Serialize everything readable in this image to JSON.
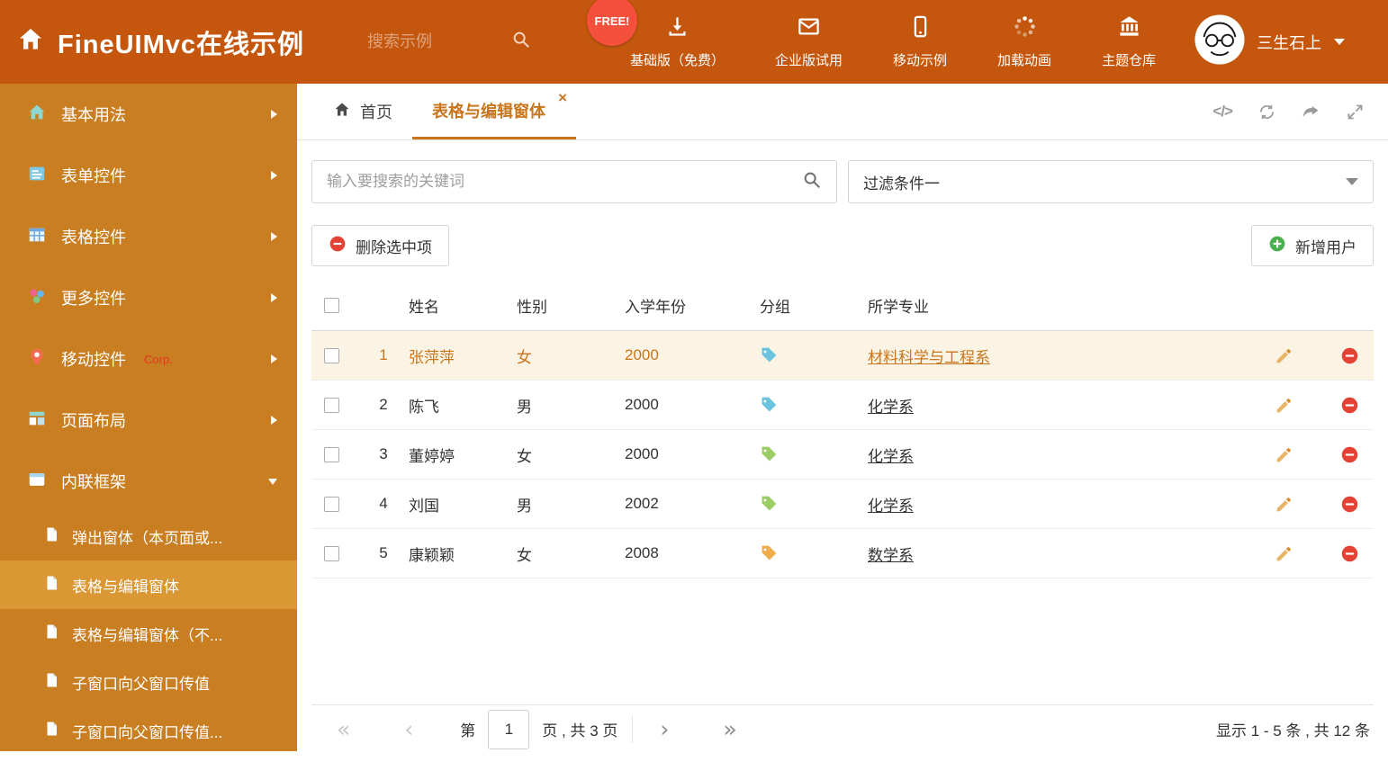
{
  "header": {
    "title": "FineUIMvc在线示例",
    "search_placeholder": "搜索示例",
    "free_badge": "FREE!",
    "nav_items": [
      {
        "label": "基础版（免费）",
        "icon": "download-icon"
      },
      {
        "label": "企业版试用",
        "icon": "mail-icon"
      },
      {
        "label": "移动示例",
        "icon": "mobile-icon"
      },
      {
        "label": "加载动画",
        "icon": "spinner-icon"
      },
      {
        "label": "主题仓库",
        "icon": "bank-icon"
      }
    ],
    "username": "三生石上"
  },
  "sidebar": {
    "items": [
      {
        "label": "基本用法",
        "icon": "home-icon"
      },
      {
        "label": "表单控件",
        "icon": "form-icon"
      },
      {
        "label": "表格控件",
        "icon": "table-icon"
      },
      {
        "label": "更多控件",
        "icon": "more-icon"
      },
      {
        "label": "移动控件",
        "badge": "Corp.",
        "icon": "pin-icon"
      },
      {
        "label": "页面布局",
        "icon": "layout-icon"
      },
      {
        "label": "内联框架",
        "icon": "frame-icon"
      }
    ],
    "subitems": [
      {
        "label": "弹出窗体（本页面或..."
      },
      {
        "label": "表格与编辑窗体",
        "active": true
      },
      {
        "label": "表格与编辑窗体（不..."
      },
      {
        "label": "子窗口向父窗口传值"
      },
      {
        "label": "子窗口向父窗口传值..."
      }
    ]
  },
  "tabbar": {
    "tabs": [
      {
        "label": "首页"
      },
      {
        "label": "表格与编辑窗体",
        "active": true,
        "closable": true
      }
    ]
  },
  "filters": {
    "search_placeholder": "输入要搜索的关键词",
    "filter_value": "过滤条件一"
  },
  "toolbar": {
    "delete_button": "删除选中项",
    "add_button": "新增用户"
  },
  "grid": {
    "columns": {
      "name": "姓名",
      "gender": "性别",
      "year": "入学年份",
      "group": "分组",
      "major": "所学专业"
    },
    "rows": [
      {
        "index": "1",
        "name": "张萍萍",
        "gender": "女",
        "year": "2000",
        "tag_color": "#6CC3E0",
        "major": "材料科学与工程系",
        "selected": true
      },
      {
        "index": "2",
        "name": "陈飞",
        "gender": "男",
        "year": "2000",
        "tag_color": "#6CC3E0",
        "major": "化学系"
      },
      {
        "index": "3",
        "name": "董婷婷",
        "gender": "女",
        "year": "2000",
        "tag_color": "#9CCC65",
        "major": "化学系"
      },
      {
        "index": "4",
        "name": "刘国",
        "gender": "男",
        "year": "2002",
        "tag_color": "#9CCC65",
        "major": "化学系"
      },
      {
        "index": "5",
        "name": "康颖颖",
        "gender": "女",
        "year": "2008",
        "tag_color": "#F0AD4E",
        "major": "数学系"
      }
    ]
  },
  "pagination": {
    "prefix": "第",
    "page": "1",
    "suffix": "页 , 共 3 页",
    "summary": "显示 1 - 5 条 , 共 12 条"
  },
  "colors": {
    "header_bg": "#C4570D",
    "sidebar_bg": "#C97E22",
    "sidebar_active_bg": "#DA9733",
    "accent": "#C8761D",
    "selected_row_bg": "#FBF3E3",
    "free_badge_bg": "#F4503C"
  }
}
